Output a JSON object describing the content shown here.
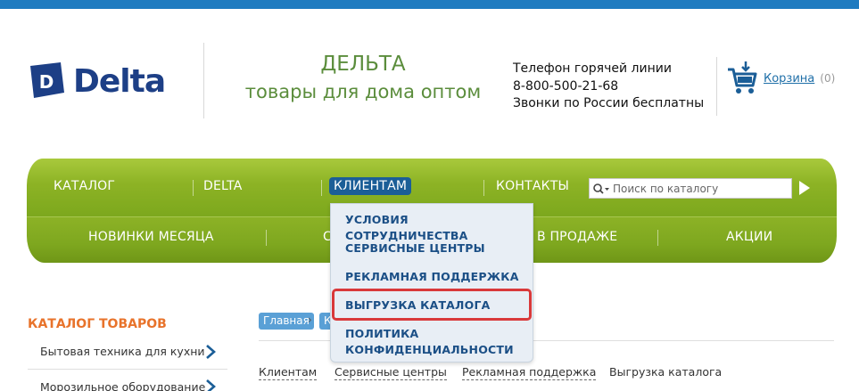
{
  "logo": {
    "text": "Delta",
    "mark_letter": "D",
    "brand_color": "#1d3f86"
  },
  "slogan": {
    "line1": "ДЕЛЬТА",
    "line2": "товары для дома оптом"
  },
  "hotline": {
    "label": "Телефон горячей линии",
    "phone": "8-800-500-21-68",
    "note": "Звонки по России бесплатны"
  },
  "cart": {
    "label": "Корзина",
    "count": "(0)",
    "icon": "cart-icon"
  },
  "nav": {
    "top": [
      "КАТАЛОГ",
      "DELTA",
      "КЛИЕНТАМ",
      "КОНТАКТЫ"
    ],
    "bottom": [
      "НОВИНКИ МЕСЯЦА",
      "С",
      "В ПРОДАЖЕ",
      "АКЦИИ"
    ],
    "active": "КЛИЕНТАМ",
    "accent_color": "#8db325",
    "active_color": "#1b5e97"
  },
  "search": {
    "placeholder": "Поиск по каталогу",
    "value": ""
  },
  "dropdown": {
    "items": [
      "УСЛОВИЯ СОТРУДНИЧЕСТВА",
      "СЕРВИСНЫЕ ЦЕНТРЫ",
      "РЕКЛАМНАЯ ПОДДЕРЖКА",
      "ВЫГРУЗКА КАТАЛОГА",
      "ПОЛИТИКА",
      "КОНФИДЕНЦИАЛЬНОСТИ"
    ],
    "highlighted": "ВЫГРУЗКА КАТАЛОГА",
    "highlight_color": "#d9393a"
  },
  "sidebar": {
    "title": "КАТАЛОГ ТОВАРОВ",
    "items": [
      "Бытовая техника для кухни",
      "Морозильное оборудование"
    ]
  },
  "breadcrumbs": [
    "Главная",
    "К"
  ],
  "subnav": [
    "Клиентам",
    "Сервисные центры",
    "Рекламная поддержка",
    "Выгрузка каталога"
  ]
}
